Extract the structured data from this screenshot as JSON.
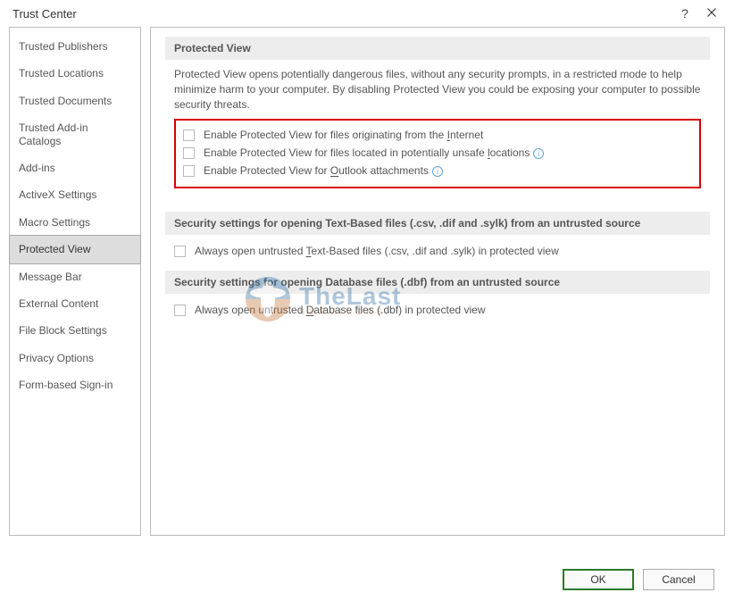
{
  "titlebar": {
    "title": "Trust Center"
  },
  "sidebar": {
    "items": [
      {
        "label": "Trusted Publishers"
      },
      {
        "label": "Trusted Locations"
      },
      {
        "label": "Trusted Documents"
      },
      {
        "label": "Trusted Add-in Catalogs"
      },
      {
        "label": "Add-ins"
      },
      {
        "label": "ActiveX Settings"
      },
      {
        "label": "Macro Settings"
      },
      {
        "label": "Protected View"
      },
      {
        "label": "Message Bar"
      },
      {
        "label": "External Content"
      },
      {
        "label": "File Block Settings"
      },
      {
        "label": "Privacy Options"
      },
      {
        "label": "Form-based Sign-in"
      }
    ],
    "selectedIndex": 7
  },
  "sections": {
    "pv": {
      "header": "Protected View",
      "desc": "Protected View opens potentially dangerous files, without any security prompts, in a restricted mode to help minimize harm to your computer. By disabling Protected View you could be exposing your computer to possible security threats.",
      "opt1_pre": "Enable Protected View for files originating from the ",
      "opt1_u": "I",
      "opt1_post": "nternet",
      "opt2_pre": "Enable Protected View for files located in potentially unsafe ",
      "opt2_u": "l",
      "opt2_post": "ocations",
      "opt3_pre": "Enable Protected View for ",
      "opt3_u": "O",
      "opt3_post": "utlook attachments"
    },
    "tb": {
      "header": "Security settings for opening Text-Based files (.csv, .dif and .sylk) from an untrusted source",
      "opt_pre": "Always open untrusted ",
      "opt_u": "T",
      "opt_post": "ext-Based files (.csv, .dif and .sylk) in protected view"
    },
    "db": {
      "header": "Security settings for opening Database files (.dbf) from an untrusted source",
      "opt_pre": "Always open untrusted ",
      "opt_u": "D",
      "opt_post": "atabase files (.dbf) in protected view"
    }
  },
  "footer": {
    "ok": "OK",
    "cancel": "Cancel"
  },
  "watermark": {
    "main": "TheLast",
    "sub": "SURVIVORS"
  }
}
